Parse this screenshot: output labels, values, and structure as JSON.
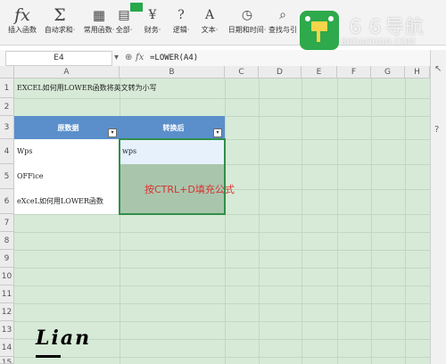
{
  "ribbon": {
    "tools": [
      {
        "icon": "fx",
        "label": "插入函数"
      },
      {
        "icon": "Σ",
        "label": "自动求和·"
      },
      {
        "icon": "▦",
        "label": "常用函数·"
      },
      {
        "icon": "▤",
        "label": "全部·"
      },
      {
        "icon": "¥",
        "label": "财务·"
      },
      {
        "icon": "?",
        "label": "逻辑·"
      },
      {
        "icon": "A",
        "label": "文本·"
      },
      {
        "icon": "◷",
        "label": "日期和时间·"
      },
      {
        "icon": "⌕",
        "label": "查找与引"
      }
    ]
  },
  "watermark": {
    "title": "６６导航",
    "url": "66DAOHAN.COM"
  },
  "formula_bar": {
    "name_box": "E4",
    "zoom_icon": "zoom-icon",
    "fx": "fx",
    "formula": "=LOWER(A4)"
  },
  "grid": {
    "columns": [
      "A",
      "B",
      "C",
      "D",
      "E",
      "F",
      "G",
      "H"
    ],
    "rows": [
      "1",
      "2",
      "3",
      "4",
      "5",
      "6",
      "7",
      "8",
      "9",
      "10",
      "11",
      "12",
      "13",
      "14",
      "15"
    ],
    "title": "EXCEL如何用LOWER函数将英文转为小写",
    "header_a": "原数据",
    "header_b": "转换后",
    "a4": "Wps",
    "b4": "wps",
    "a5": "OFFice",
    "a6": "eXceL如何用LOWER函数",
    "hint": "按CTRL+D填充公式"
  },
  "signature": "Lian",
  "colors": {
    "selection": "#2f8f4a",
    "header_fill": "#5a8fcb",
    "hint": "#d93030",
    "grid_bg": "#d7ead7"
  }
}
